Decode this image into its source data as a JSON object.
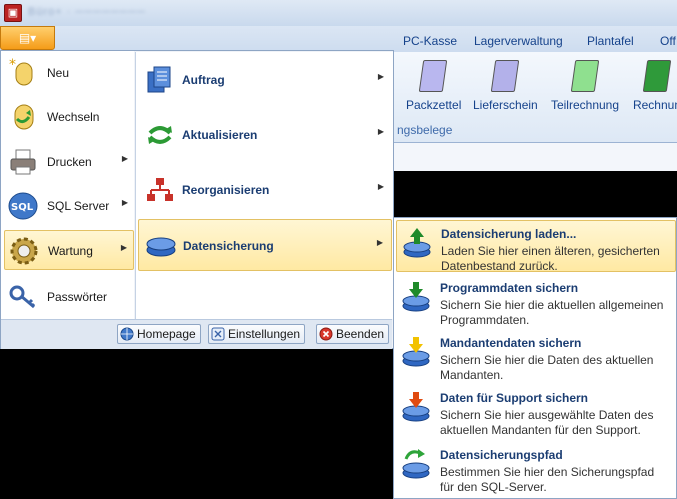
{
  "titlebar": {
    "blurred_text": "Büro+ · ────────"
  },
  "app_button": {
    "label": "▤▾"
  },
  "ribbon": {
    "tabs": [
      "PC-Kasse",
      "Lagerverwaltung",
      "Plantafel",
      "Off"
    ],
    "buttons": [
      {
        "label": "Packzettel",
        "color": "#b9b7ef"
      },
      {
        "label": "Lieferschein",
        "color": "#b3b1ea"
      },
      {
        "label": "Teilrechnung",
        "color": "#8fe08f"
      },
      {
        "label": "Rechnun",
        "color": "#2f9a3a"
      }
    ],
    "group_label": "ngsbelege"
  },
  "main_menu": {
    "items": [
      {
        "label": "Neu",
        "icon": "new-database-icon",
        "submenu": false
      },
      {
        "label": "Wechseln",
        "icon": "switch-database-icon",
        "submenu": false
      },
      {
        "label": "Drucken",
        "icon": "printer-icon",
        "submenu": true
      },
      {
        "label": "SQL Server",
        "icon": "sql-server-icon",
        "submenu": true
      },
      {
        "label": "Wartung",
        "icon": "gear-icon",
        "submenu": true,
        "selected": true
      },
      {
        "label": "Passwörter",
        "icon": "key-icon",
        "submenu": false
      }
    ],
    "submenu": [
      {
        "label": "Auftrag",
        "icon": "documents-icon"
      },
      {
        "label": "Aktualisieren",
        "icon": "refresh-icon"
      },
      {
        "label": "Reorganisieren",
        "icon": "network-icon"
      },
      {
        "label": "Datensicherung",
        "icon": "database-icon",
        "selected": true
      }
    ],
    "bottom_buttons": [
      {
        "label": "Homepage",
        "icon": "globe-icon"
      },
      {
        "label": "Einstellungen",
        "icon": "settings-icon"
      },
      {
        "label": "Beenden",
        "icon": "exit-icon"
      }
    ]
  },
  "flyout": {
    "items": [
      {
        "title": "Datensicherung laden...",
        "desc": "Laden Sie hier einen älteren, gesicherten Datenbestand zurück.",
        "arrow_color": "#1f8a2a",
        "selected": true
      },
      {
        "title": "Programmdaten sichern",
        "desc": "Sichern Sie hier die aktuellen allgemeinen Programmdaten.",
        "arrow_color": "#1f8a2a"
      },
      {
        "title": "Mandantendaten sichern",
        "desc": "Sichern Sie hier die Daten des aktuellen Mandanten.",
        "arrow_color": "#f2c200"
      },
      {
        "title": "Daten für Support sichern",
        "desc": "Sichern Sie hier ausgewählte Daten des aktuellen Mandanten für den Support.",
        "arrow_color": "#e04b10"
      },
      {
        "title": "Datensicherungspfad",
        "desc": "Bestimmen Sie hier den Sicherungspfad für den SQL-Server.",
        "arrow_color": "#2ea43a"
      }
    ]
  },
  "colors": {
    "accent": "#1b3d72",
    "highlight": "#ffe9a3",
    "app_button": "#f59c18"
  }
}
